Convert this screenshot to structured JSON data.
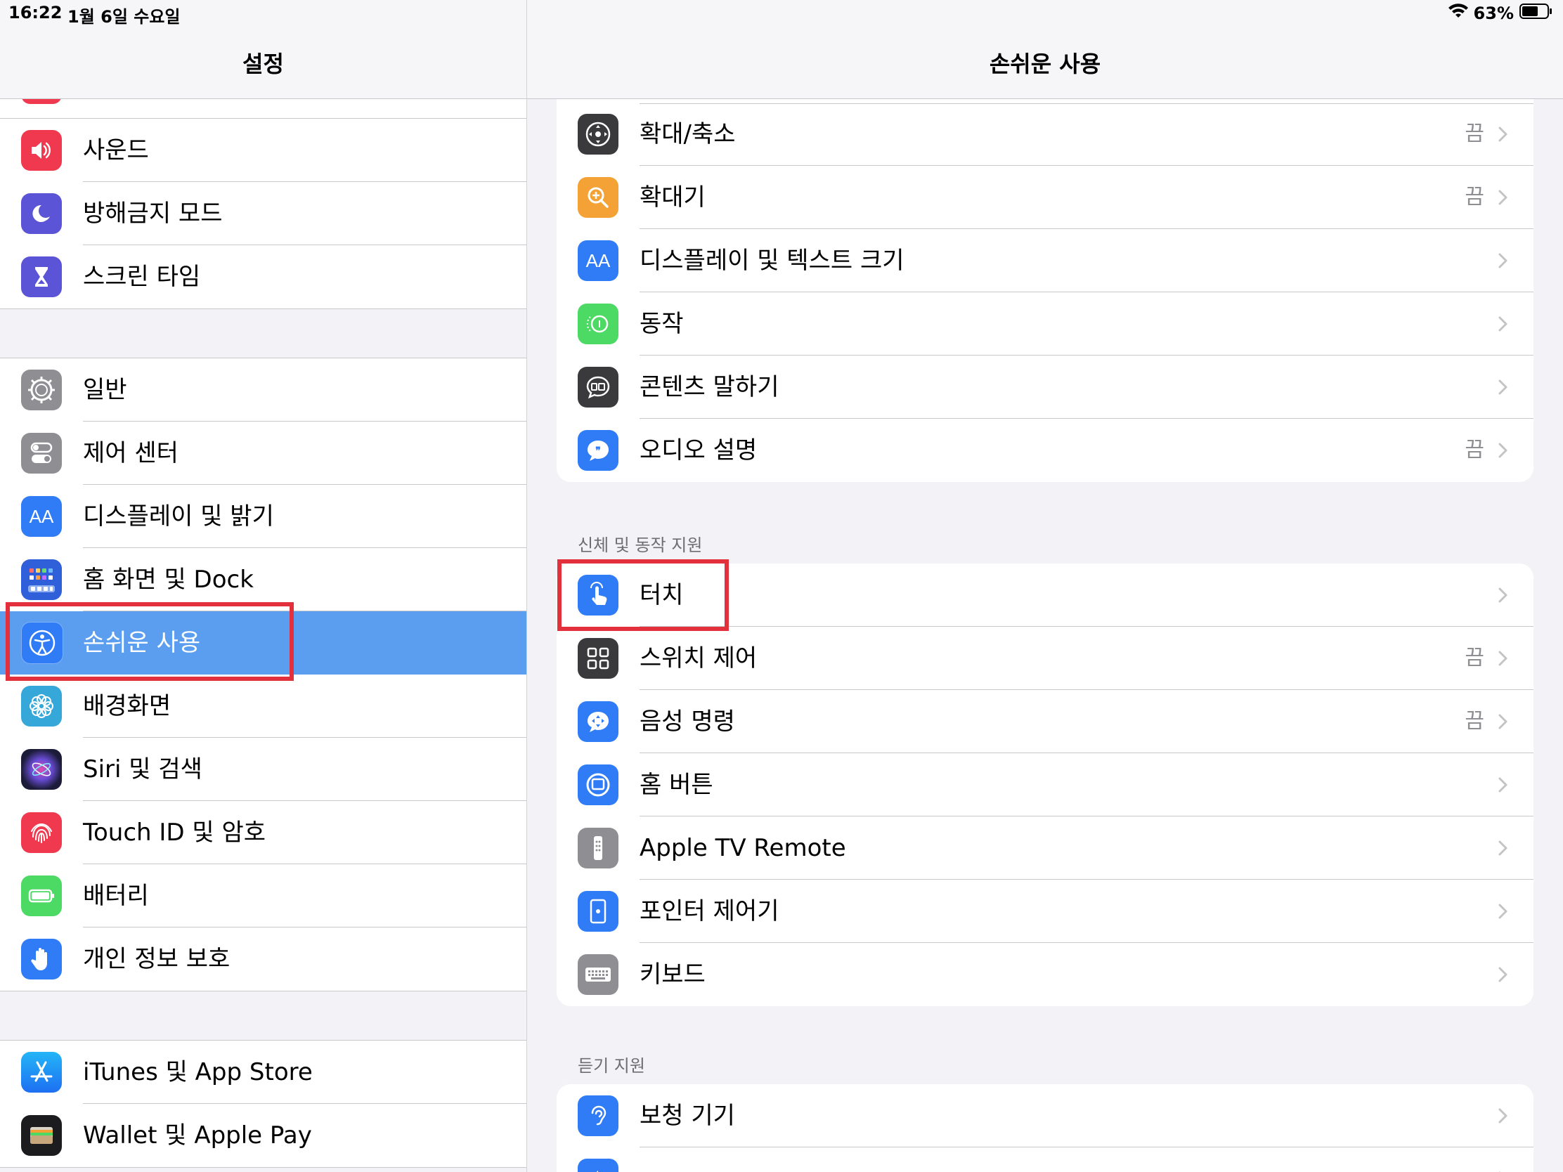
{
  "status": {
    "time": "16:22",
    "date": "1월 6일 수요일",
    "battery": "63%"
  },
  "left": {
    "title": "설정",
    "group1": [
      {
        "label": "사운드",
        "icon": "speaker-icon",
        "color": "#f0394f"
      },
      {
        "label": "방해금지 모드",
        "icon": "moon-icon",
        "color": "#5b54d6"
      },
      {
        "label": "스크린 타임",
        "icon": "hourglass-icon",
        "color": "#5b54d6"
      }
    ],
    "group2": [
      {
        "label": "일반",
        "icon": "gear-icon",
        "color": "#8e8e93"
      },
      {
        "label": "제어 센터",
        "icon": "toggles-icon",
        "color": "#8e8e93"
      },
      {
        "label": "디스플레이 및 밝기",
        "icon": "text-size-icon",
        "color": "#2f7cf6"
      },
      {
        "label": "홈 화면 및 Dock",
        "icon": "home-grid-icon",
        "color": "#2f5fd9"
      },
      {
        "label": "손쉬운 사용",
        "icon": "accessibility-icon",
        "color": "#2f7cf6",
        "selected": true
      },
      {
        "label": "배경화면",
        "icon": "flower-icon",
        "color": "#35a7d8"
      },
      {
        "label": "Siri 및 검색",
        "icon": "siri-icon",
        "color": "#1c1c3a"
      },
      {
        "label": "Touch ID 및 암호",
        "icon": "fingerprint-icon",
        "color": "#f0394f"
      },
      {
        "label": "배터리",
        "icon": "battery-icon",
        "color": "#4cd964"
      },
      {
        "label": "개인 정보 보호",
        "icon": "hand-icon",
        "color": "#2f7cf6"
      }
    ],
    "group3": [
      {
        "label": "iTunes 및 App Store",
        "icon": "app-store-icon",
        "color": "#2f8cf6"
      },
      {
        "label": "Wallet 및 Apple Pay",
        "icon": "wallet-icon",
        "color": "#1c1c1e"
      }
    ]
  },
  "right": {
    "title": "손쉬운 사용",
    "vision_rows": [
      {
        "label": "확대/축소",
        "value": "끔",
        "icon": "zoom-icon",
        "color": "#3a3a3c"
      },
      {
        "label": "확대기",
        "value": "끔",
        "icon": "magnifier-icon",
        "color": "#f4a236"
      },
      {
        "label": "디스플레이 및 텍스트 크기",
        "value": "",
        "icon": "text-size-icon",
        "color": "#2f7cf6"
      },
      {
        "label": "동작",
        "value": "",
        "icon": "motion-icon",
        "color": "#4cd964"
      },
      {
        "label": "콘텐츠 말하기",
        "value": "",
        "icon": "speech-bubble-icon",
        "color": "#3a3a3c"
      },
      {
        "label": "오디오 설명",
        "value": "끔",
        "icon": "quote-bubble-icon",
        "color": "#2f7cf6"
      }
    ],
    "physical_header": "신체 및 동작 지원",
    "physical_rows": [
      {
        "label": "터치",
        "value": "",
        "icon": "touch-hand-icon",
        "color": "#2f7cf6"
      },
      {
        "label": "스위치 제어",
        "value": "끔",
        "icon": "switch-grid-icon",
        "color": "#3a3a3c"
      },
      {
        "label": "음성 명령",
        "value": "끔",
        "icon": "voice-control-icon",
        "color": "#2f7cf6"
      },
      {
        "label": "홈 버튼",
        "value": "",
        "icon": "home-button-icon",
        "color": "#2f7cf6"
      },
      {
        "label": "Apple TV Remote",
        "value": "",
        "icon": "remote-icon",
        "color": "#8e8e93"
      },
      {
        "label": "포인터 제어기",
        "value": "",
        "icon": "pointer-icon",
        "color": "#2f7cf6"
      },
      {
        "label": "키보드",
        "value": "",
        "icon": "keyboard-icon",
        "color": "#8e8e93"
      }
    ],
    "hearing_header": "듣기 지원",
    "hearing_rows": [
      {
        "label": "보청 기기",
        "value": "",
        "icon": "ear-icon",
        "color": "#2f7cf6"
      },
      {
        "label": "",
        "value": "",
        "icon": "speaker-icon",
        "color": "#2f7cf6"
      }
    ]
  },
  "highlight_color": "#e2303d"
}
